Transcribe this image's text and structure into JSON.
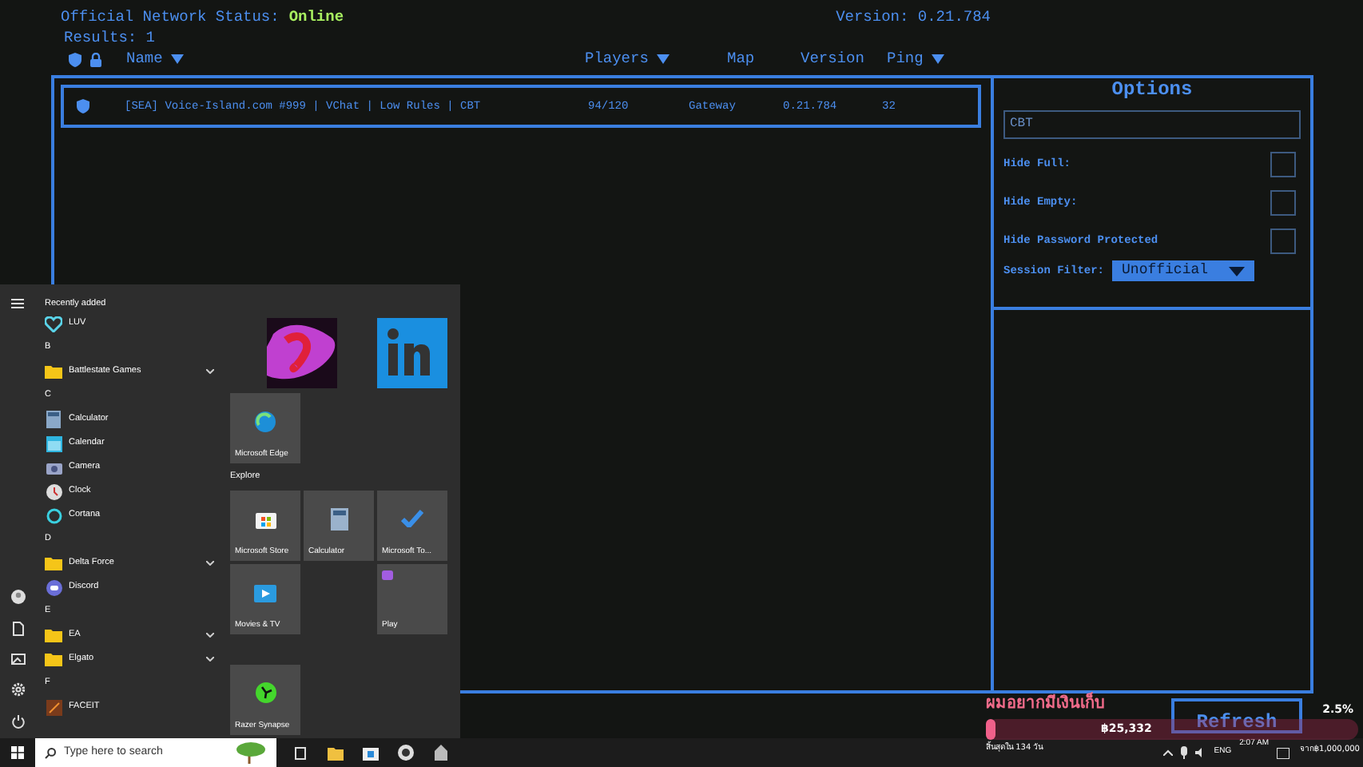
{
  "network": {
    "label": "Official Network Status:",
    "status": "Online",
    "version": "Version: 0.21.784",
    "results": "Results: 1"
  },
  "columns": [
    {
      "label": "Name",
      "sortable": true
    },
    {
      "label": "Players",
      "sortable": true
    },
    {
      "label": "Map",
      "sortable": false
    },
    {
      "label": "Version",
      "sortable": false
    },
    {
      "label": "Ping",
      "sortable": true
    }
  ],
  "servers": [
    {
      "name": "[SEA] Voice-Island.com #999 | VChat | Low Rules | CBT",
      "players": "94/120",
      "map": "Gateway",
      "version": "0.21.784",
      "ping": "32",
      "selected": true
    }
  ],
  "options": {
    "title": "Options",
    "search_value": "CBT",
    "toggles": [
      {
        "label": "Hide Full:",
        "checked": false
      },
      {
        "label": "Hide Empty:",
        "checked": false
      },
      {
        "label": "Hide Password Protected",
        "checked": false
      }
    ],
    "session_filter": {
      "label": "Session Filter:",
      "value": "Unofficial"
    }
  },
  "refresh": "Refresh",
  "start_menu": {
    "section": "Recently added",
    "items": [
      {
        "kind": "app",
        "label": "LUV"
      },
      {
        "kind": "letter",
        "label": "B"
      },
      {
        "kind": "folder",
        "label": "Battlestate Games"
      },
      {
        "kind": "letter",
        "label": "C"
      },
      {
        "kind": "app",
        "label": "Calculator"
      },
      {
        "kind": "app",
        "label": "Calendar"
      },
      {
        "kind": "app",
        "label": "Camera"
      },
      {
        "kind": "app",
        "label": "Clock"
      },
      {
        "kind": "app",
        "label": "Cortana"
      },
      {
        "kind": "letter",
        "label": "D"
      },
      {
        "kind": "folder",
        "label": "Delta Force"
      },
      {
        "kind": "app",
        "label": "Discord"
      },
      {
        "kind": "letter",
        "label": "E"
      },
      {
        "kind": "folder",
        "label": "EA"
      },
      {
        "kind": "folder",
        "label": "Elgato"
      },
      {
        "kind": "letter",
        "label": "F"
      },
      {
        "kind": "app",
        "label": "FACEIT"
      }
    ],
    "edge": {
      "kind": "edge",
      "label": "Microsoft Edge"
    },
    "explore": "Explore",
    "explore_tiles": [
      {
        "kind": "store",
        "label": "Microsoft Store"
      },
      {
        "kind": "calculator",
        "label": "Calculator"
      },
      {
        "kind": "todo",
        "label": "Microsoft To..."
      },
      {
        "kind": "movies",
        "label": "Movies & TV"
      },
      {
        "kind": "empty"
      },
      {
        "kind": "play",
        "label": "Play"
      }
    ],
    "bottom_tile": {
      "kind": "razer",
      "label": "Razer Synapse"
    }
  },
  "taskbar": {
    "search_placeholder": "Type here to search",
    "language": "ENG",
    "time": "2:07 AM"
  },
  "donation": {
    "title": "ผมอยากมีเงินเก็บ",
    "amount": "฿25,332",
    "level": 0.025,
    "percent": "2.5%",
    "remaining": "สิ้นสุดใน 134 วัน",
    "goal": "จาก฿1,000,000"
  }
}
